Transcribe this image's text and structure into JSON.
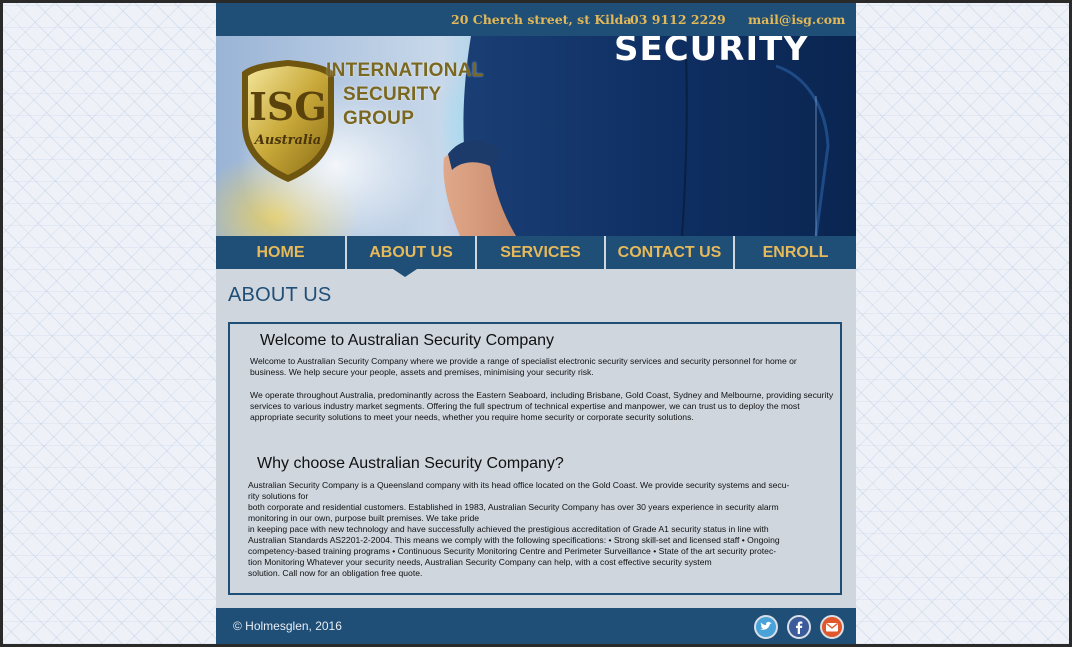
{
  "topbar": {
    "address": "20 Cherch street, st Kilda",
    "phone": "03 9112 2229",
    "email": "mail@isg.com"
  },
  "hero": {
    "shirt_text": "SECURITY",
    "logo_mark": "ISG",
    "logo_script": "Australia",
    "logo_line1": "INTERNATIONAL",
    "logo_line2": "SECURITY",
    "logo_line3": "GROUP"
  },
  "nav": {
    "items": [
      {
        "label": "HOME"
      },
      {
        "label": "ABOUT US"
      },
      {
        "label": "SERVICES"
      },
      {
        "label": "CONTACT US"
      },
      {
        "label": "ENROLL"
      }
    ],
    "active": "ABOUT US"
  },
  "main": {
    "title": "ABOUT US",
    "welcome_heading": "Welcome to Australian Security Company",
    "welcome_p1": "Welcome to Australian Security Company where we provide a range of specialist electronic security services and security personnel for home or business. We help secure your people, assets and premises, minimising your security risk.",
    "welcome_p2": "We operate throughout Australia, predominantly across the Eastern Seaboard, including Brisbane, Gold Coast, Sydney and Melbourne, providing security services to various industry market segments. Offering the full spectrum of technical expertise and manpower, we can trust us to deploy the most appropriate security solutions to meet your needs, whether you require home security or corporate security solutions.",
    "why_heading": "Why choose Australian Security Company?",
    "why_lines": [
      "Australian Security Company is a Queensland company with its head office located on the Gold Coast. We provide security systems and secu-",
      "rity solutions for",
      "both corporate and residential customers. Established in 1983, Australian Security Company has over 30 years experience in security alarm",
      "monitoring in our own, purpose built premises.  We take pride",
      "in keeping pace with new technology and have successfully achieved the prestigious accreditation of Grade A1 security status in line with",
      "Australian Standards AS2201-2-2004. This means we comply with the following specifications: • Strong skill-set and licensed staff • Ongoing",
      "competency-based training programs • Continuous Security Monitoring Centre and Perimeter Surveillance • State of the art security protec-",
      "tion Monitoring Whatever your security needs, Australian Security Company can help, with a cost effective security system",
      "solution. Call now for an obligation free quote."
    ]
  },
  "footer": {
    "copyright": "© Holmesglen, 2016",
    "social": [
      "twitter-icon",
      "facebook-icon",
      "email-icon"
    ]
  },
  "colors": {
    "brand_blue": "#1f4e77",
    "accent_gold": "#e6b95a",
    "page_bg": "#cfd6de"
  }
}
